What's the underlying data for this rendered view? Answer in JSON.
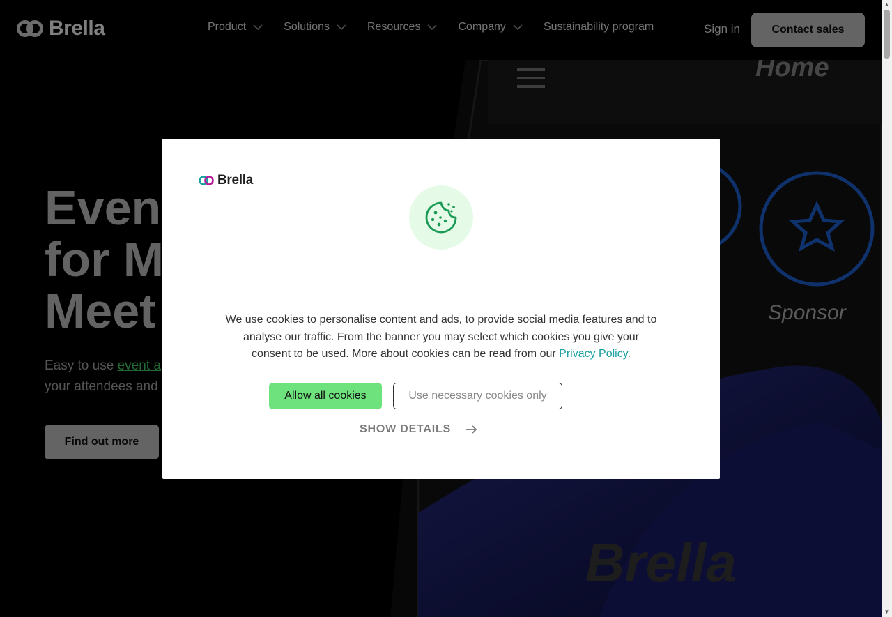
{
  "brand": {
    "name": "Brella"
  },
  "nav": {
    "items": [
      {
        "label": "Product",
        "has_dropdown": true
      },
      {
        "label": "Solutions",
        "has_dropdown": true
      },
      {
        "label": "Resources",
        "has_dropdown": true
      },
      {
        "label": "Company",
        "has_dropdown": true
      },
      {
        "label": "Sustainability program",
        "has_dropdown": false
      }
    ],
    "sign_in": "Sign in",
    "contact": "Contact sales"
  },
  "hero": {
    "title_line1": "Event",
    "title_line2": "for M",
    "title_line3": "Meet",
    "sub_prefix": "Easy to use ",
    "sub_link": "event a",
    "sub_line2": "your attendees and",
    "cta": "Find out more",
    "phone_home": "Home",
    "phone_sponsor": "Sponsor",
    "watermark": "Brella"
  },
  "cookie_modal": {
    "logo_text": "Brella",
    "text": "We use cookies to personalise content and ads, to provide social media features and to analyse our traffic. From the banner you may select which cookies you give your consent to be used. More about cookies can be read from our ",
    "privacy_link": "Privacy Policy",
    "text_end": ".",
    "allow_all": "Allow all cookies",
    "necessary_only": "Use necessary cookies only",
    "show_details": "SHOW DETAILS"
  },
  "colors": {
    "accent_green": "#6ee27d",
    "link_teal": "#19a0a0",
    "cookie_circle_bg": "#e5fbe8"
  }
}
